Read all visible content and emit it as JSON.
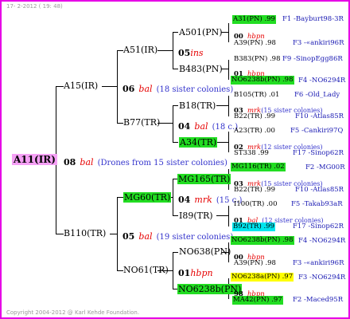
{
  "header": {
    "date": "17-  2-2012 ( 19: 48)"
  },
  "footer": {
    "copyright": "Copyright 2004-2012 @ Karl Kehde Foundation."
  },
  "root": {
    "label": "A11(IR)"
  },
  "g1": {
    "gen": "08",
    "mark": "bal",
    "note": "(Drones from 15 sister colonies)",
    "sire": "A15(IR)",
    "dam": "B110(TR)"
  },
  "g2": {
    "upper": {
      "gen": "06",
      "mark": "bal",
      "note": "(18 sister colonies)",
      "sire": "A51(IR)",
      "dam": "B77(TR)"
    },
    "lower": {
      "gen": "05",
      "mark": "bal",
      "note": "(19 sister colonies)",
      "sire": "MG60(TR)",
      "dam": "NO61(TR)"
    }
  },
  "g3": {
    "a": {
      "gen": "05",
      "mark": "ins",
      "sire": "A501(PN)",
      "dam": "B483(PN)"
    },
    "b": {
      "gen": "04",
      "mark": "bal",
      "note": "(18 c.)",
      "sire": "B18(TR)",
      "dam": "A34(TR)"
    },
    "c": {
      "gen": "04",
      "mark": "mrk",
      "note": "(15 c.)",
      "sire": "MG165(TR)",
      "dam": "I89(TR)"
    },
    "d": {
      "gen": "01",
      "mark": "hbpn",
      "sire": "NO638(PN)",
      "dam": "NO6238b(PN)"
    }
  },
  "leaves": [
    {
      "top": "A31(PN) .99",
      "right": "F1 -Bayburt98-3R",
      "gen": "00",
      "mark": "hbpn",
      "bot": "A39(PN) .98",
      "right2": "F3 -«ankiri96R"
    },
    {
      "top": "B383(PN) .98",
      "right": "F9 -SinopEgg86R",
      "gen": "01",
      "mark": "hbpn",
      "bot": "NO6238b(PN) .98",
      "right2": "F4 -NO6294R"
    },
    {
      "top": "B105(TR) .01",
      "right": "F6 -Old_Lady",
      "gen": "03",
      "mark": "mrk",
      "note": "(15 sister colonies)",
      "bot": "B22(TR) .99",
      "right2": "F10 -Atlas85R"
    },
    {
      "top": "A23(TR) .00",
      "right": "F5 -Cankiri97Q",
      "gen": "02",
      "mark": "mrk",
      "note": "(12 sister colonies)",
      "bot": "ST338 .99",
      "right2": "F17 -Sinop62R"
    },
    {
      "top": "MG116(TR) .02",
      "right": "F2 -MG00R",
      "gen": "03",
      "mark": "mrk",
      "note": "(15 sister colonies)",
      "bot": "B22(TR) .99",
      "right2": "F10 -Atlas85R"
    },
    {
      "top": "I100(TR) .00",
      "right": "F5 -Takab93aR",
      "gen": "01",
      "mark": "bal",
      "note": "(12 sister colonies)",
      "bot": "B92(TR) .99",
      "right2": "F17 -Sinop62R"
    },
    {
      "top": "NO6238b(PN) .98",
      "right": "F4 -NO6294R",
      "gen": "00",
      "mark": "hbpn",
      "bot": "A39(PN) .98",
      "right2": "F3 -«ankiri96R"
    },
    {
      "top": "NO6238a(PN) .97",
      "right": "F3 -NO6294R",
      "gen": "98",
      "mark": "hbpn",
      "bot": "MA42(PN) .97",
      "right2": "F2 -Maced95R"
    }
  ]
}
